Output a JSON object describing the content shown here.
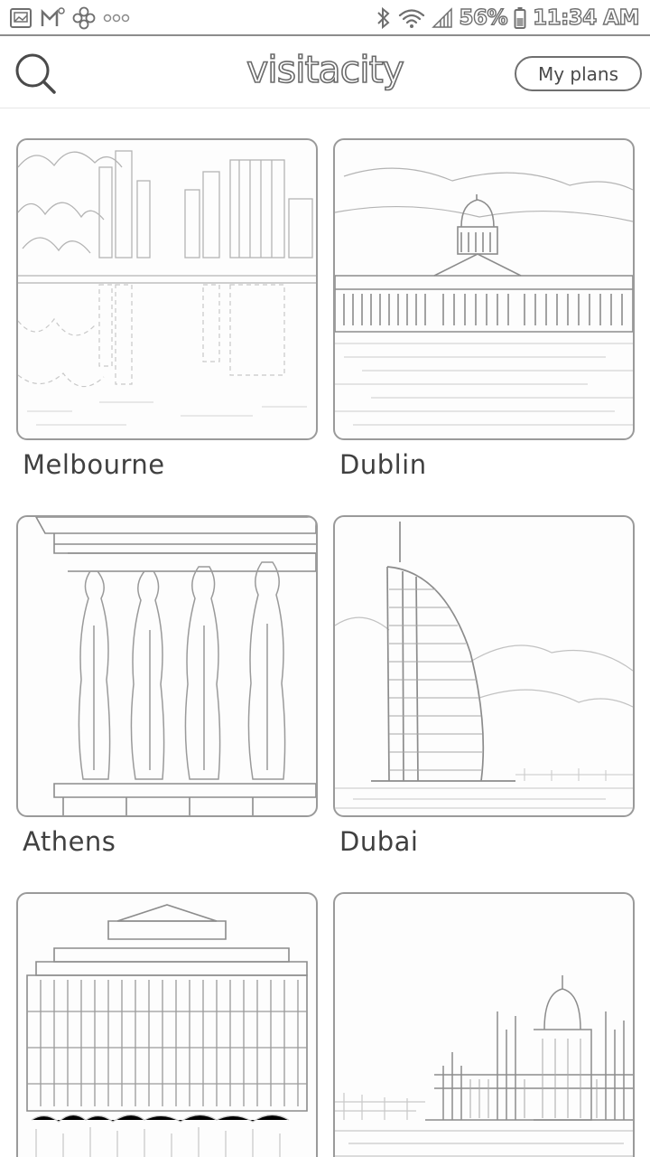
{
  "status_bar": {
    "battery": "56%",
    "time": "11:34 AM",
    "left_icons": [
      "gallery-notification-icon",
      "gmail-notification-icon",
      "pinwheel-notification-icon",
      "more-notifications-icon"
    ],
    "right_icons": [
      "bluetooth-icon",
      "wifi-icon",
      "signal-icon",
      "battery-icon"
    ]
  },
  "header": {
    "logo": "visitacity",
    "search_icon": "search-icon",
    "my_plans_label": "My plans"
  },
  "cities": [
    {
      "name": "Melbourne",
      "photo": "melbourne-skyline-photo"
    },
    {
      "name": "Dublin",
      "photo": "dublin-custom-house-photo"
    },
    {
      "name": "Athens",
      "photo": "athens-caryatids-photo"
    },
    {
      "name": "Dubai",
      "photo": "dubai-burj-al-arab-photo"
    },
    {
      "name": "",
      "photo": "las-vegas-hotel-photo"
    },
    {
      "name": "",
      "photo": "budapest-parliament-photo"
    }
  ]
}
